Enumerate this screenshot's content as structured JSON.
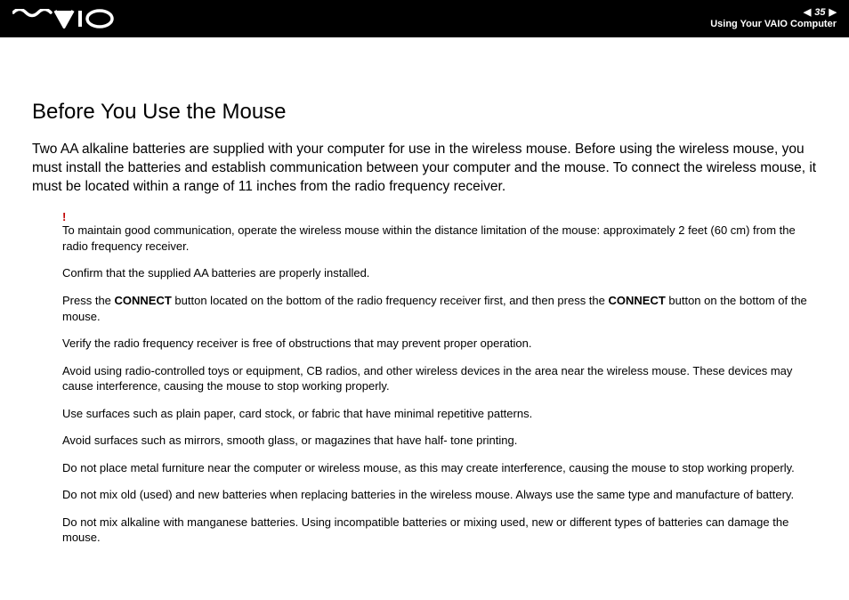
{
  "header": {
    "page_number": "35",
    "section": "Using Your VAIO Computer"
  },
  "title": "Before You Use the Mouse",
  "intro": "Two AA alkaline batteries are supplied with your computer for use in the wireless mouse. Before using the wireless mouse, you must install the batteries and establish communication between your computer and the mouse. To connect the wireless mouse, it must be located within a range of 11 inches from the radio frequency receiver.",
  "warning_mark": "!",
  "paragraphs": {
    "p1": "To maintain good communication, operate the wireless mouse within the distance limitation of the mouse: approximately 2 feet (60 cm) from the radio frequency receiver.",
    "p2": "Confirm that the supplied AA batteries are properly installed.",
    "p3a": "Press the ",
    "connect1": "CONNECT",
    "p3b": " button located on the bottom of the radio frequency receiver first, and then press the ",
    "connect2": "CONNECT",
    "p3c": " button on the bottom of the mouse.",
    "p4": "Verify the radio frequency receiver is free of obstructions that may prevent proper operation.",
    "p5": "Avoid using radio-controlled toys or equipment, CB radios, and other wireless devices in the area near the wireless mouse. These devices may cause interference, causing the mouse to stop working properly.",
    "p6": "Use surfaces such as plain paper, card stock, or fabric that have minimal repetitive patterns.",
    "p7": "Avoid surfaces such as mirrors, smooth glass, or magazines that have half- tone printing.",
    "p8": "Do not place metal furniture near the computer or wireless mouse, as this may create interference, causing the mouse to stop working properly.",
    "p9": "Do not mix old (used) and new batteries when replacing batteries in the wireless mouse. Always use the same type and manufacture of battery.",
    "p10": "Do not mix alkaline with manganese batteries. Using incompatible batteries or mixing used, new or different types of batteries can damage the mouse."
  }
}
